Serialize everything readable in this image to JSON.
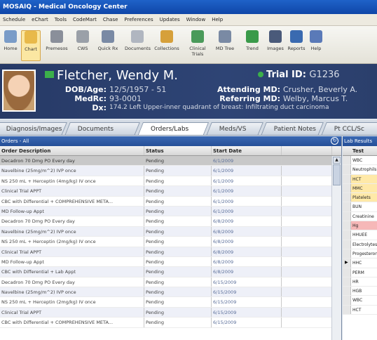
{
  "app": {
    "title": "MOSAIQ - Medical Oncology Center"
  },
  "menu": [
    "Schedule",
    "eChart",
    "Tools",
    "CodeMart",
    "Chase",
    "Preferences",
    "Updates",
    "Window",
    "Help"
  ],
  "toolbar": [
    {
      "label": "Home",
      "icon": "home-icon",
      "color": "#7a9cc8"
    },
    {
      "label": "Chart",
      "icon": "chart-folder-icon",
      "color": "#e8b94a",
      "active": true
    },
    {
      "label": "Premesos",
      "icon": "premeds-icon",
      "color": "#8a8f9a"
    },
    {
      "label": "CWS",
      "icon": "cws-icon",
      "color": "#9aa0a8"
    },
    {
      "label": "Quick Rx",
      "icon": "quick-rx-icon",
      "color": "#7a8aa4"
    },
    {
      "label": "Documents",
      "icon": "documents-icon",
      "color": "#b0b6c0"
    },
    {
      "label": "Collections",
      "icon": "collections-icon",
      "color": "#d6a03a"
    },
    {
      "label": "Clinical Trials",
      "icon": "clinical-trials-icon",
      "color": "#4a9a5a"
    },
    {
      "label": "MD Tree",
      "icon": "md-tree-icon",
      "color": "#7a8aa4"
    },
    {
      "label": "Trend",
      "icon": "trend-icon",
      "color": "#3a9a4a"
    },
    {
      "label": "Images",
      "icon": "images-icon",
      "color": "#4a5a7a"
    },
    {
      "label": "Reports",
      "icon": "reports-icon",
      "color": "#3a6ab0"
    },
    {
      "label": "Help",
      "icon": "help-icon",
      "color": "#5a7ab8"
    }
  ],
  "patient": {
    "name": "Fletcher, Wendy M.",
    "dob_label": "DOB/Age:",
    "dob": "12/5/1957 - 51",
    "medrc_label": "MedRc:",
    "medrc": "93-0001",
    "dx_label": "Dx:",
    "dx": "174.2 Left Upper-inner quadrant of breast: Infiltrating duct carcinoma",
    "trial_label": "Trial ID:",
    "trial": "G1236",
    "attending_label": "Attending MD:",
    "attending": "Crusher, Beverly A.",
    "referring_label": "Referring MD:",
    "referring": "Welby, Marcus T."
  },
  "tabs": [
    {
      "label": "Diagnosis/Images"
    },
    {
      "label": "Documents"
    },
    {
      "label": "Orders/Labs",
      "active": true
    },
    {
      "label": "Meds/VS"
    },
    {
      "label": "Patient Notes"
    },
    {
      "label": "Pt CCL/Sc"
    }
  ],
  "orders": {
    "title": "Orders - All",
    "headers": [
      "Order Description",
      "Status",
      "Start Date",
      ""
    ],
    "rows": [
      {
        "desc": "Decadron 70 Dmg PO Every day",
        "status": "Pending",
        "date": "6/1/2009",
        "sel": true
      },
      {
        "desc": "Navelbine (25mg/m^2) IVP once",
        "status": "Pending",
        "date": "6/1/2009"
      },
      {
        "desc": "NS 250 mL + Herceptin (4mg/kg) IV once",
        "status": "Pending",
        "date": "6/1/2009"
      },
      {
        "desc": "Clinical Trial APPT",
        "status": "Pending",
        "date": "6/1/2009"
      },
      {
        "desc": "CBC with Differential + COMPREHENSIVE META...",
        "status": "Pending",
        "date": "6/1/2009"
      },
      {
        "desc": "MD Follow-up Appt",
        "status": "Pending",
        "date": "6/1/2009"
      },
      {
        "desc": "Decadron 70 Dmg PO Every day",
        "status": "Pending",
        "date": "6/8/2009"
      },
      {
        "desc": "Navelbine (25mg/m^2) IVP once",
        "status": "Pending",
        "date": "6/8/2009"
      },
      {
        "desc": "NS 250 mL + Herceptin (2mg/kg) IV once",
        "status": "Pending",
        "date": "6/8/2009"
      },
      {
        "desc": "Clinical Trial APPT",
        "status": "Pending",
        "date": "6/8/2009"
      },
      {
        "desc": "MD Follow-up Appt",
        "status": "Pending",
        "date": "6/8/2009"
      },
      {
        "desc": "CBC with Differential + Lab Appt",
        "status": "Pending",
        "date": "6/8/2009"
      },
      {
        "desc": "Decadron 70 Dmg PO Every day",
        "status": "Pending",
        "date": "6/15/2009"
      },
      {
        "desc": "Navelbine (25mg/m^2) IVP once",
        "status": "Pending",
        "date": "6/15/2009"
      },
      {
        "desc": "NS 250 mL + Herceptin (2mg/kg) IV once",
        "status": "Pending",
        "date": "6/15/2009"
      },
      {
        "desc": "Clinical Trial APPT",
        "status": "Pending",
        "date": "6/15/2009"
      },
      {
        "desc": "CBC with Differential + COMPREHENSIVE META...",
        "status": "Pending",
        "date": "6/15/2009"
      }
    ]
  },
  "labs": {
    "title": "Lab Results",
    "header": "Test",
    "rows": [
      {
        "t": "WBC"
      },
      {
        "t": "Neutrophils"
      },
      {
        "t": "HCT",
        "c": "y"
      },
      {
        "t": "MMC",
        "c": "y"
      },
      {
        "t": "Platelets",
        "c": "y"
      },
      {
        "t": "BUN"
      },
      {
        "t": "Creatinine"
      },
      {
        "t": "Hg",
        "c": "r"
      },
      {
        "t": "HHUEE"
      },
      {
        "t": "Electrolytes"
      },
      {
        "t": "Progesterone"
      },
      {
        "t": "HHC",
        "cur": true
      },
      {
        "t": "PERM"
      },
      {
        "t": "HR"
      },
      {
        "t": "HGB"
      },
      {
        "t": "WBC"
      },
      {
        "t": "HCT"
      }
    ]
  }
}
